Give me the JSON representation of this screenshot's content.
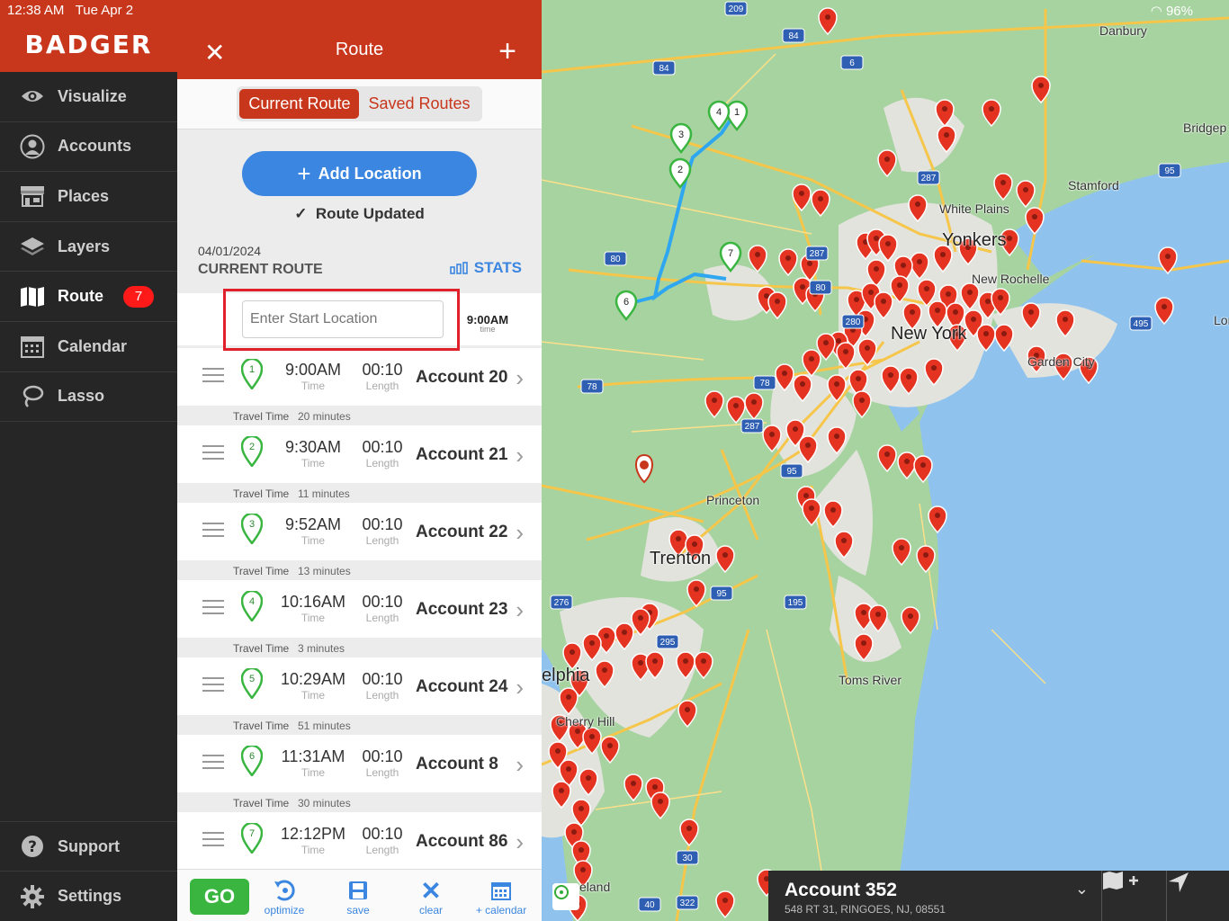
{
  "status": {
    "time": "12:38 AM",
    "date": "Tue Apr 2",
    "battery": "96%"
  },
  "brand": "BADGER",
  "nav": {
    "items": [
      {
        "label": "Visualize",
        "icon": "eye-icon"
      },
      {
        "label": "Accounts",
        "icon": "user-icon"
      },
      {
        "label": "Places",
        "icon": "store-icon"
      },
      {
        "label": "Layers",
        "icon": "layers-icon"
      },
      {
        "label": "Route",
        "icon": "map-icon",
        "badge": "7"
      },
      {
        "label": "Calendar",
        "icon": "calendar-icon"
      },
      {
        "label": "Lasso",
        "icon": "lasso-icon"
      }
    ],
    "support": "Support",
    "settings": "Settings"
  },
  "panel": {
    "title": "Route",
    "tabs": [
      "Current Route",
      "Saved Routes"
    ],
    "add_location": "Add Location",
    "route_updated": "Route Updated",
    "date": "04/01/2024",
    "current_route": "CURRENT ROUTE",
    "stats": "STATS",
    "start_placeholder": "Enter Start Location",
    "start_time": "9:00AM",
    "start_time_label": "time",
    "time_label": "Time",
    "length_label": "Length",
    "travel_label": "Travel Time",
    "stops": [
      {
        "num": "1",
        "time": "9:00AM",
        "length": "00:10",
        "account": "Account 20",
        "travel": "20 minutes"
      },
      {
        "num": "2",
        "time": "9:30AM",
        "length": "00:10",
        "account": "Account 21",
        "travel": "11 minutes"
      },
      {
        "num": "3",
        "time": "9:52AM",
        "length": "00:10",
        "account": "Account 22",
        "travel": "13 minutes"
      },
      {
        "num": "4",
        "time": "10:16AM",
        "length": "00:10",
        "account": "Account 23",
        "travel": "3 minutes"
      },
      {
        "num": "5",
        "time": "10:29AM",
        "length": "00:10",
        "account": "Account 24",
        "travel": "51 minutes"
      },
      {
        "num": "6",
        "time": "11:31AM",
        "length": "00:10",
        "account": "Account 8",
        "travel": "30 minutes"
      },
      {
        "num": "7",
        "time": "12:12PM",
        "length": "00:10",
        "account": "Account 86"
      }
    ],
    "toolbar": {
      "go": "GO",
      "optimize": "optimize",
      "save": "save",
      "clear": "clear",
      "calendar": "+ calendar"
    }
  },
  "map": {
    "cities": [
      "Danbury",
      "Bridgep",
      "Stamford",
      "White Plains",
      "Yonkers",
      "New Rochelle",
      "New York",
      "Garden City",
      "Long",
      "Princeton",
      "Trenton",
      "Toms River",
      "elphia",
      "Cherry Hill",
      "eland"
    ],
    "highways": [
      "209",
      "84",
      "84",
      "6",
      "84",
      "287",
      "95",
      "80",
      "287",
      "80",
      "280",
      "495",
      "78",
      "78",
      "287",
      "95",
      "276",
      "95",
      "195",
      "295",
      "40",
      "322",
      "30"
    ],
    "selected": {
      "name": "Account 352",
      "address": "548 RT 31, RINGOES, NJ, 08551"
    },
    "route_pins": [
      "1",
      "2",
      "3",
      "4",
      "6",
      "7"
    ]
  },
  "colors": {
    "brand": "#c8361c",
    "accent": "#3b86e0",
    "go": "#39b540"
  }
}
